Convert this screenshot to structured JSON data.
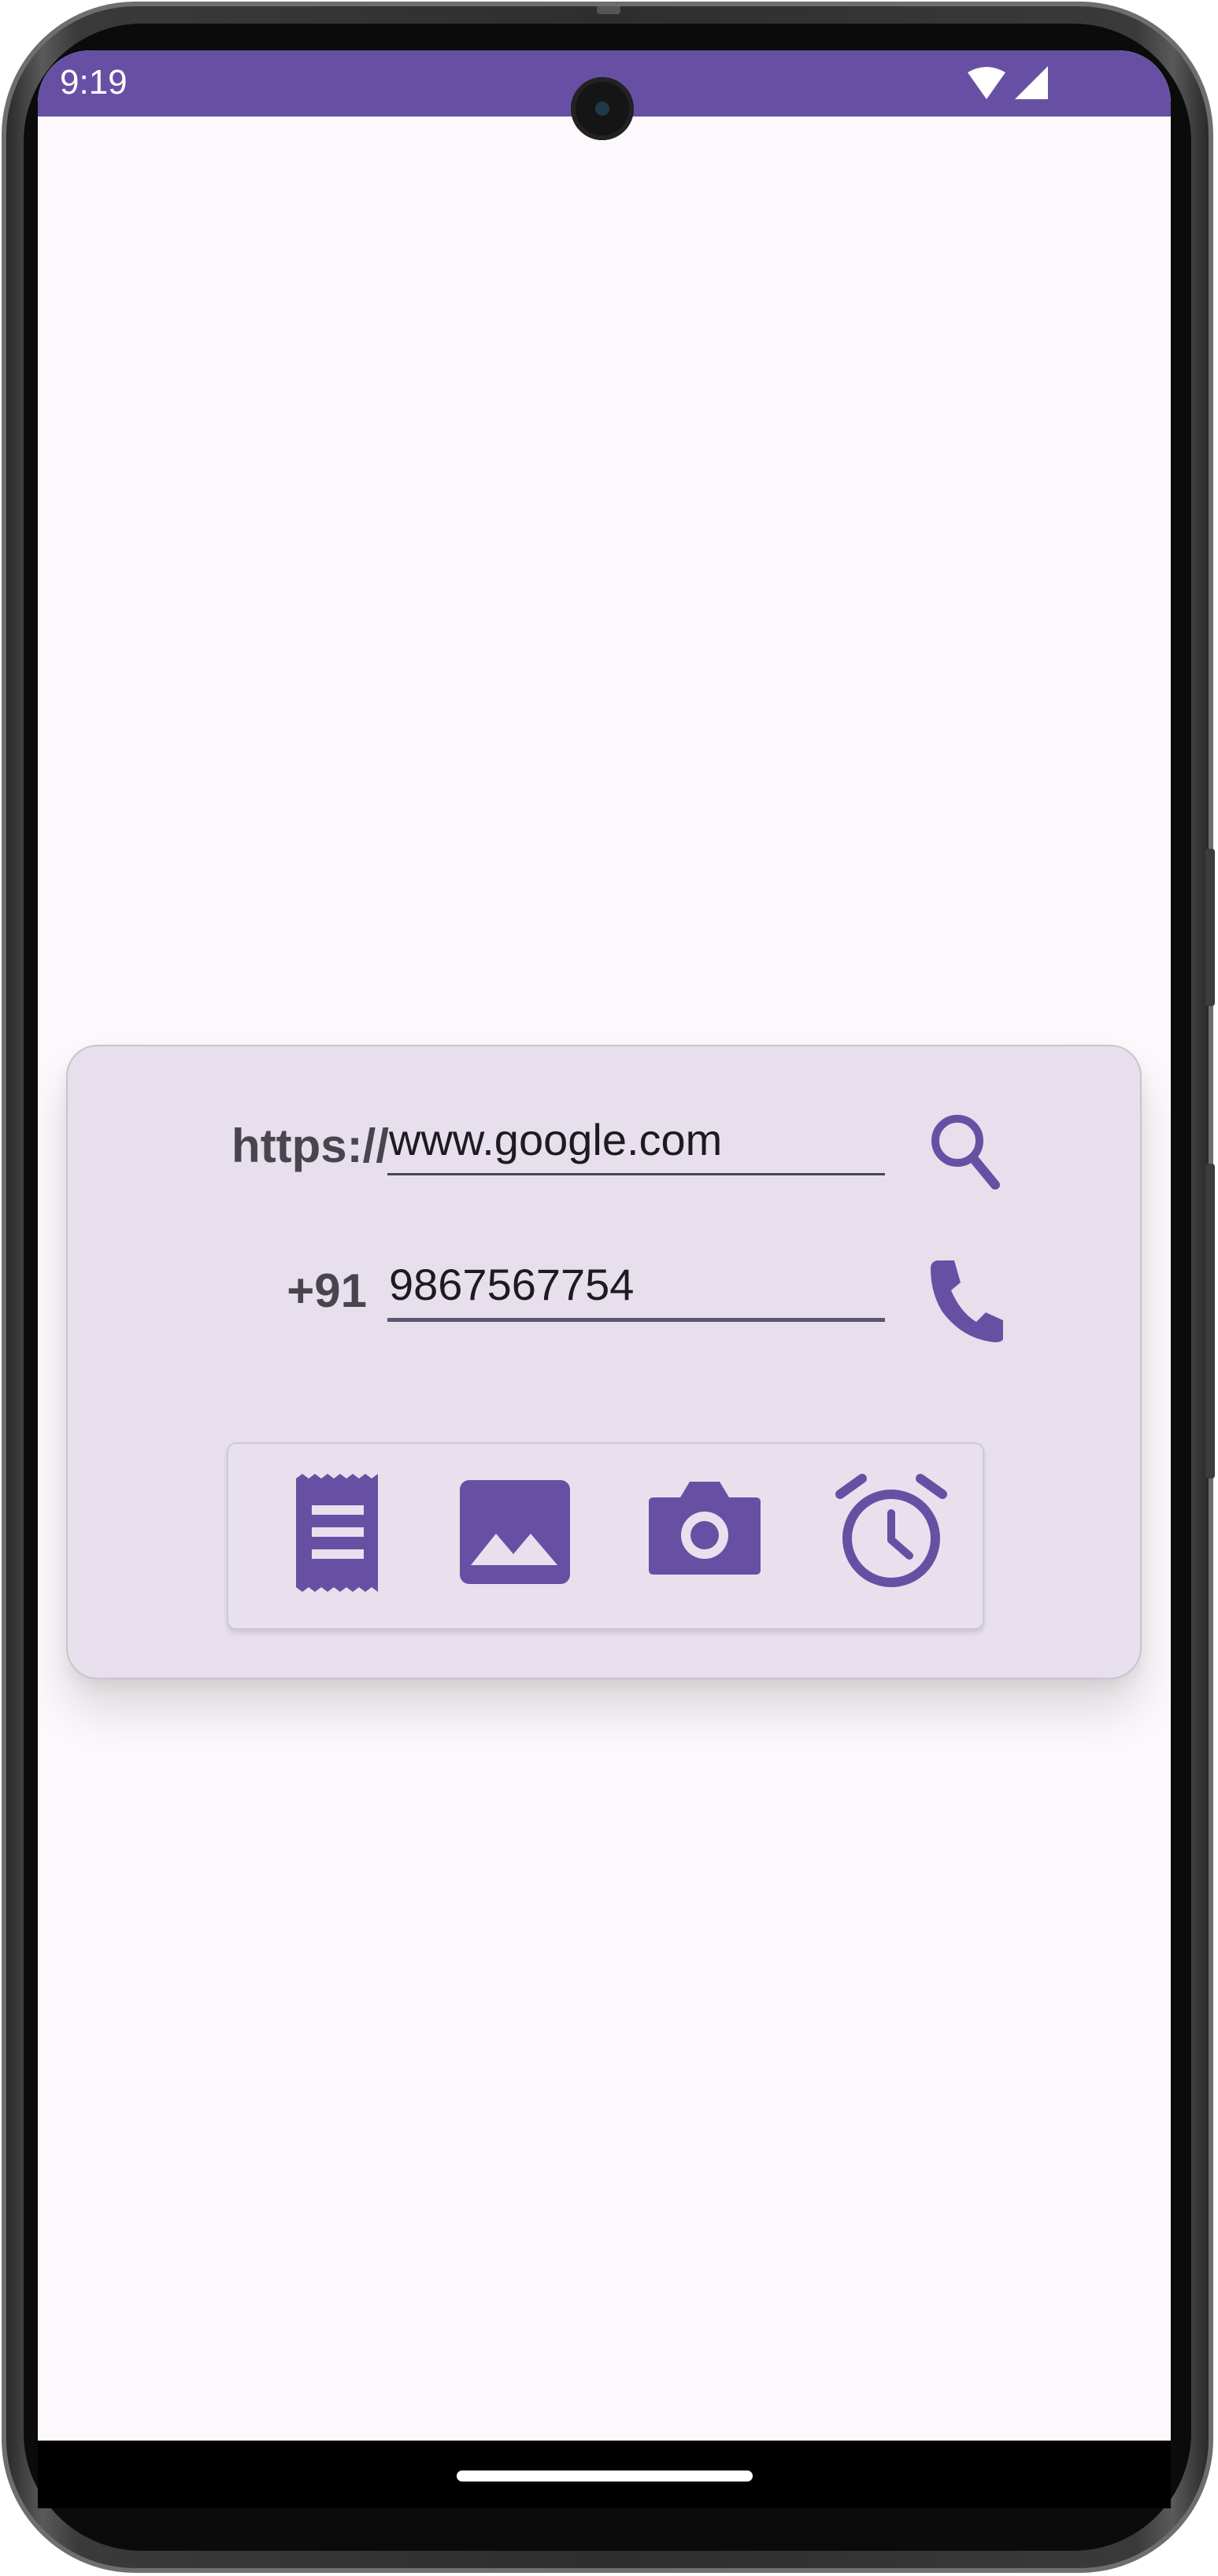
{
  "status_bar": {
    "time": "9:19",
    "icons": [
      "wifi-icon",
      "cellular-signal-icon"
    ]
  },
  "form": {
    "url_prefix": "https://",
    "url_value": "www.google.com",
    "phone_prefix": "+91",
    "phone_value": "9867567754"
  },
  "actions": {
    "search_icon": "search-icon",
    "call_icon": "phone-icon"
  },
  "toolbar": {
    "items": [
      "receipt-icon",
      "image-icon",
      "camera-icon",
      "alarm-icon"
    ]
  },
  "colors": {
    "primary": "#6750a4",
    "card_background": "#e7e0ec",
    "screen_background": "#fdf8fc",
    "text": "#1d1b20"
  }
}
